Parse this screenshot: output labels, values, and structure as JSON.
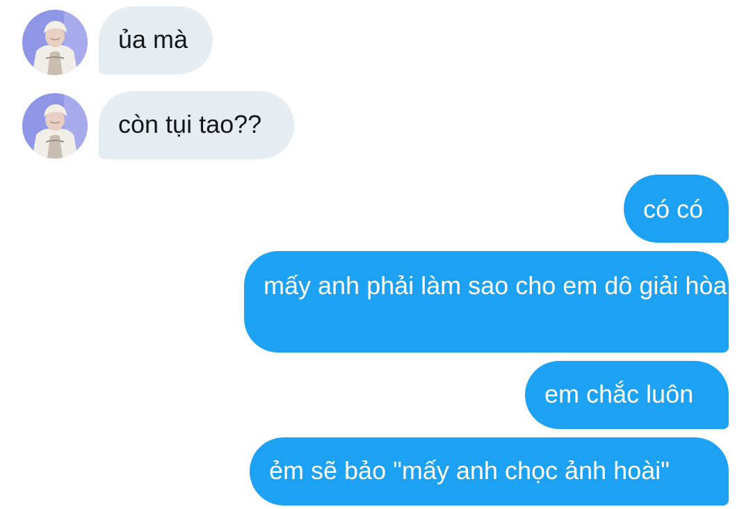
{
  "conversation": {
    "incoming": [
      {
        "text": "ủa mà",
        "avatar": "profile-photo"
      },
      {
        "text": "còn tụi tao??",
        "avatar": "profile-photo"
      }
    ],
    "outgoing": [
      {
        "text": "có có"
      },
      {
        "text": "mấy anh phải làm sao cho em dô giải hòa"
      },
      {
        "text": "em chắc luôn"
      },
      {
        "text": "ẻm sẽ bảo \"mấy anh chọc ảnh hoài\""
      }
    ]
  },
  "colors": {
    "incoming_bubble": "#e6ecf0",
    "incoming_text": "#14171a",
    "outgoing_bubble": "#1da1f2",
    "outgoing_text": "#ffffff",
    "avatar_background": "#8f96e6"
  }
}
